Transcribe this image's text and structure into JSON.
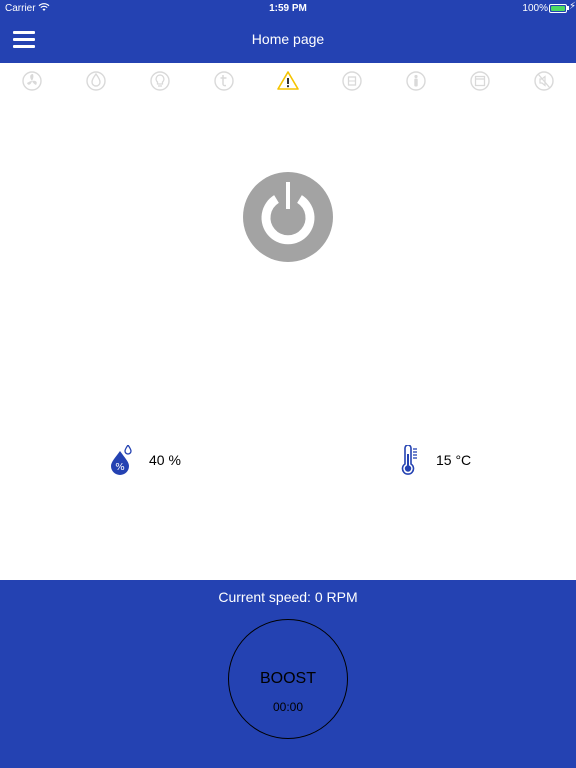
{
  "status_bar": {
    "carrier": "Carrier",
    "time": "1:59 PM",
    "battery": "100%"
  },
  "header": {
    "title": "Home page"
  },
  "icon_bar": [
    {
      "icon": "fan-icon",
      "active": false
    },
    {
      "icon": "drop-icon",
      "active": false
    },
    {
      "icon": "bulb-icon",
      "active": false
    },
    {
      "icon": "timer-icon",
      "active": false
    },
    {
      "icon": "warning-icon",
      "active": true
    },
    {
      "icon": "filter-icon",
      "active": false
    },
    {
      "icon": "person-icon",
      "active": false
    },
    {
      "icon": "calendar-icon",
      "active": false
    },
    {
      "icon": "mute-icon",
      "active": false
    }
  ],
  "readings": {
    "humidity": "40 %",
    "temperature": "15 °C"
  },
  "bottom": {
    "speed_text": "Current speed: 0 RPM",
    "boost_label": "BOOST",
    "boost_time": "00:00"
  },
  "colors": {
    "brand_blue": "#2442b2",
    "power_gray": "#a3a3a3",
    "warning_yellow": "#f5c400",
    "icon_inactive": "#d9d9d9"
  }
}
